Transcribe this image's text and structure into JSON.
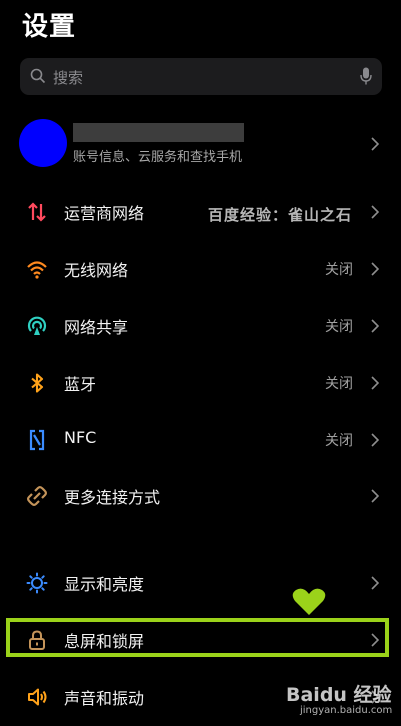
{
  "header": {
    "title": "设置"
  },
  "search": {
    "placeholder": "搜索"
  },
  "account": {
    "subtitle": "账号信息、云服务和查找手机",
    "avatar_color": "#0000ff"
  },
  "rows": [
    {
      "label": "运营商网络",
      "value": "",
      "icon": "signal-arrows-icon",
      "color": "#ff4a5e"
    },
    {
      "label": "无线网络",
      "value": "关闭",
      "icon": "wifi-icon",
      "color": "#ff8a1f"
    },
    {
      "label": "网络共享",
      "value": "关闭",
      "icon": "hotspot-icon",
      "color": "#2fd0c2"
    },
    {
      "label": "蓝牙",
      "value": "关闭",
      "icon": "bluetooth-icon",
      "color": "#ffa21a"
    },
    {
      "label": "NFC",
      "value": "关闭",
      "icon": "nfc-icon",
      "color": "#3b8cff"
    },
    {
      "label": "更多连接方式",
      "value": "",
      "icon": "link-icon",
      "color": "#c4945a"
    },
    {
      "label": "显示和亮度",
      "value": "",
      "icon": "brightness-icon",
      "color": "#3b8cff"
    },
    {
      "label": "息屏和锁屏",
      "value": "",
      "icon": "lock-icon",
      "color": "#c4945a"
    },
    {
      "label": "声音和振动",
      "value": "",
      "icon": "speaker-icon",
      "color": "#ffa21a"
    }
  ],
  "watermarks": {
    "experience": "百度经验：雀山之石",
    "baidu_logo": "Baidu 经验",
    "baidu_site": "jingyan.baidu.com"
  },
  "highlight_color": "#9bd21a"
}
